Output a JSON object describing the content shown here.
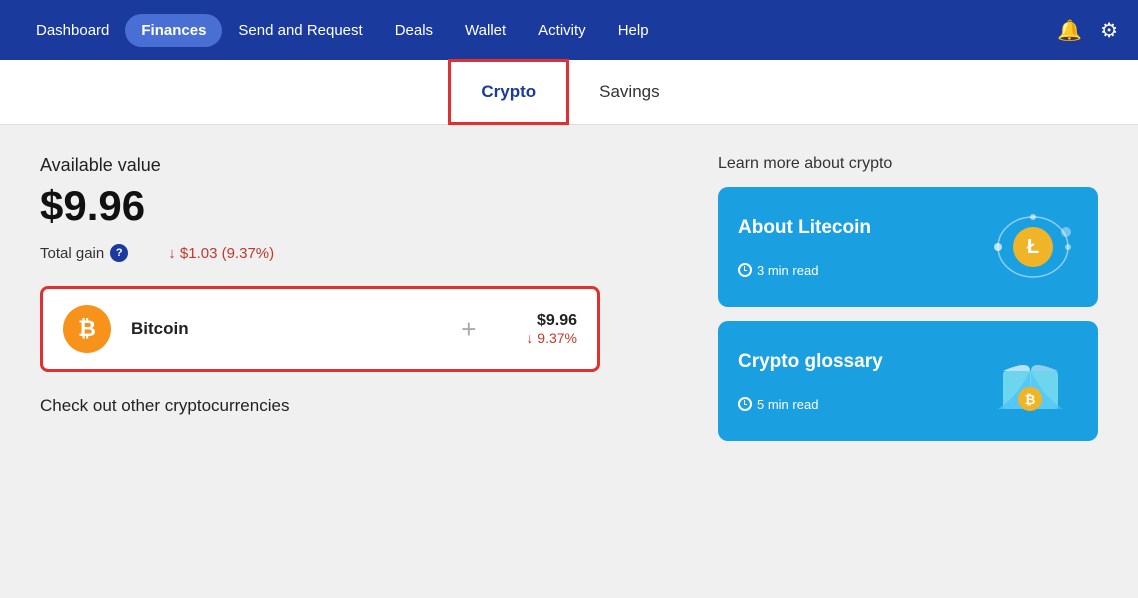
{
  "nav": {
    "items": [
      {
        "label": "Dashboard",
        "active": false
      },
      {
        "label": "Finances",
        "active": true
      },
      {
        "label": "Send and Request",
        "active": false
      },
      {
        "label": "Deals",
        "active": false
      },
      {
        "label": "Wallet",
        "active": false
      },
      {
        "label": "Activity",
        "active": false
      },
      {
        "label": "Help",
        "active": false
      }
    ],
    "bell_icon": "🔔",
    "gear_icon": "⚙"
  },
  "subnav": {
    "items": [
      {
        "label": "Crypto",
        "active": true
      },
      {
        "label": "Savings",
        "active": false
      }
    ]
  },
  "main": {
    "available_label": "Available value",
    "available_value": "$9.96",
    "total_gain_label": "Total gain",
    "total_gain_value": "↓ $1.03 (9.37%)",
    "bitcoin": {
      "name": "Bitcoin",
      "plus": "+",
      "usd": "$9.96",
      "pct": "↓ 9.37%"
    },
    "check_out_label": "Check out other cryptocurrencies"
  },
  "learn": {
    "label": "Learn more about crypto",
    "cards": [
      {
        "title": "About Litecoin",
        "time": "3 min read"
      },
      {
        "title": "Crypto glossary",
        "time": "5 min read"
      }
    ]
  }
}
